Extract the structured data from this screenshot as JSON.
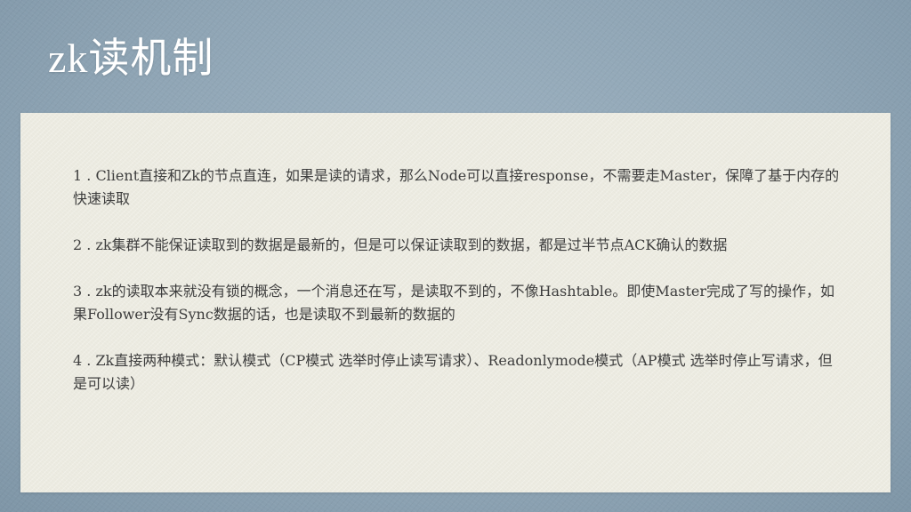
{
  "slide": {
    "title": "zk读机制",
    "points": [
      "1 . Client直接和Zk的节点直连，如果是读的请求，那么Node可以直接response，不需要走Master，保障了基于内存的快速读取",
      "2 . zk集群不能保证读取到的数据是最新的，但是可以保证读取到的数据，都是过半节点ACK确认的数据",
      "3 . zk的读取本来就没有锁的概念，一个消息还在写，是读取不到的，不像Hashtable。即使Master完成了写的操作，如果Follower没有Sync数据的话，也是读取不到最新的数据的",
      "4 . Zk直接两种模式：默认模式（CP模式 选举时停止读写请求）、Readonlymode模式（AP模式 选举时停止写请求，但是可以读）"
    ]
  },
  "colors": {
    "background": "#8fa5b5",
    "panel": "#ecebe1",
    "title_text": "#ffffff",
    "body_text": "#3d3d3d"
  }
}
